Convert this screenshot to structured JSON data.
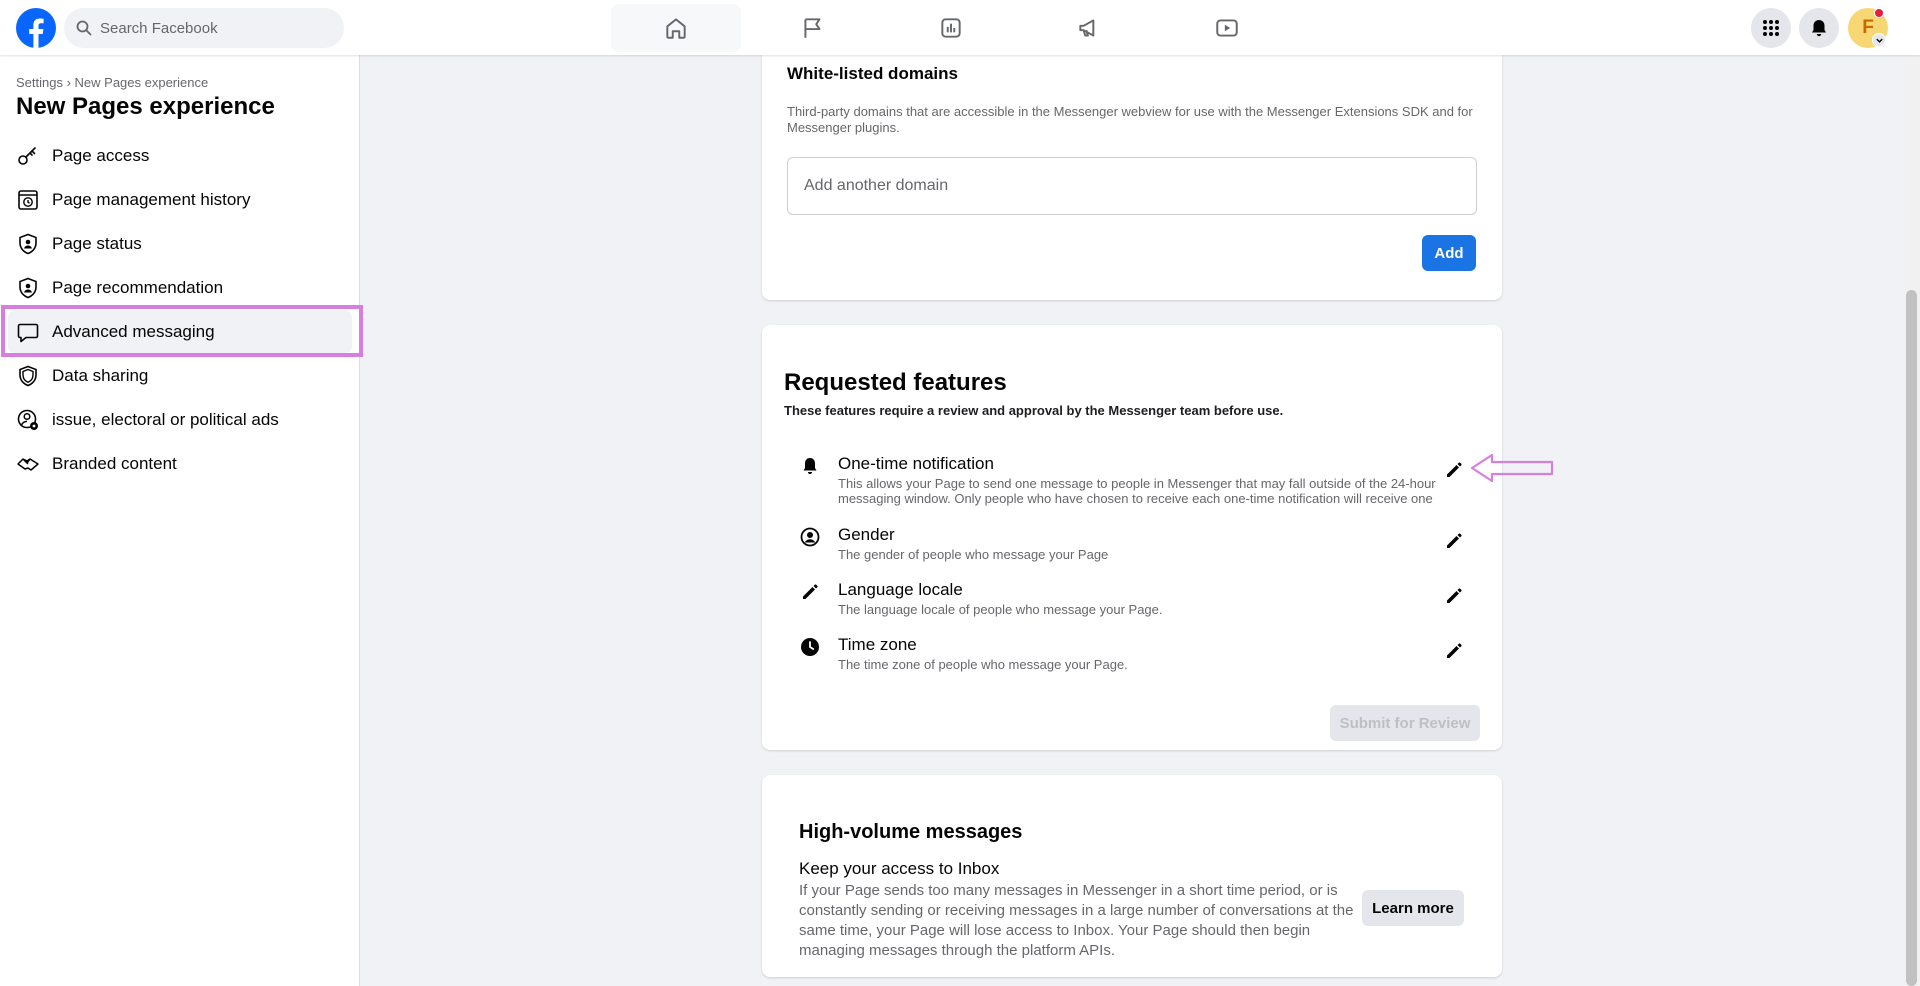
{
  "topbar": {
    "search_placeholder": "Search Facebook",
    "nav_tabs": [
      "home-icon",
      "flag-icon",
      "insights-icon",
      "megaphone-icon",
      "video-icon"
    ],
    "right_buttons": [
      "menu-grid-icon",
      "bell-icon"
    ],
    "avatar_letter": "F",
    "brand_color": "#0866ff"
  },
  "sidebar": {
    "breadcrumb": "Settings › New Pages experience",
    "title": "New Pages experience",
    "items": [
      {
        "label": "Page access",
        "icon": "key-icon"
      },
      {
        "label": "Page management history",
        "icon": "history-icon"
      },
      {
        "label": "Page status",
        "icon": "shield-person-icon"
      },
      {
        "label": "Page recommendation",
        "icon": "shield-person-icon"
      },
      {
        "label": "Advanced messaging",
        "icon": "chat-bubble-icon",
        "active": true
      },
      {
        "label": "Data sharing",
        "icon": "shield-icon"
      },
      {
        "label": "issue, electoral or political ads",
        "icon": "person-gear-icon"
      },
      {
        "label": "Branded content",
        "icon": "handshake-icon"
      }
    ],
    "highlight_color": "#d77fe0"
  },
  "whitelist": {
    "title": "White-listed domains",
    "description": "Third-party domains that are accessible in the Messenger webview for use with the Messenger Extensions SDK and for Messenger plugins.",
    "input_value": "",
    "input_placeholder": "Add another domain",
    "add_label": "Add"
  },
  "requested_features": {
    "title": "Requested features",
    "subtitle": "These features require a review and approval by the Messenger team before use.",
    "features": [
      {
        "name": "One-time notification",
        "icon": "bell-icon",
        "description": "This allows your Page to send one message to people in Messenger that may fall outside of the 24-hour messaging window. Only people who have chosen to receive each one-time notification will receive one"
      },
      {
        "name": "Gender",
        "icon": "person-circle-icon",
        "description": "The gender of people who message your Page"
      },
      {
        "name": "Language locale",
        "icon": "pencil-icon",
        "description": "The language locale of people who message your Page."
      },
      {
        "name": "Time zone",
        "icon": "clock-icon",
        "description": "The time zone of people who message your Page."
      }
    ],
    "submit_label": "Submit for Review"
  },
  "high_volume": {
    "title": "High-volume messages",
    "subtitle": "Keep your access to Inbox",
    "description": "If your Page sends too many messages in Messenger in a short time period, or is constantly sending or receiving messages in a large number of conversations at the same time, your Page will lose access to Inbox. Your Page should then begin managing messages through the platform APIs.",
    "learn_more_label": "Learn more"
  }
}
